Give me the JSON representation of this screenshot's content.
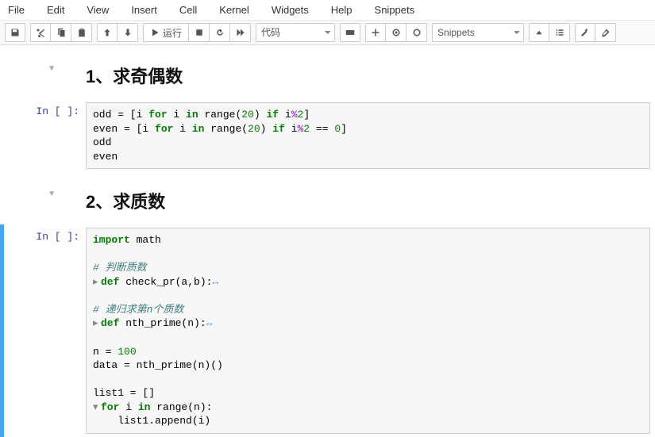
{
  "menu": {
    "file": "File",
    "edit": "Edit",
    "view": "View",
    "insert": "Insert",
    "cell": "Cell",
    "kernel": "Kernel",
    "widgets": "Widgets",
    "help": "Help",
    "snippets": "Snippets"
  },
  "toolbar": {
    "run_label": "运行",
    "celltype_selected": "代码",
    "snippets_selected": "Snippets"
  },
  "cells": {
    "md1_heading": "1、求奇偶数",
    "md2_heading": "2、求质数",
    "prompt1": "In [ ]:",
    "prompt2": "In [ ]:",
    "code1": {
      "l1a": "odd = [i ",
      "l1b": "for",
      "l1c": " i ",
      "l1d": "in",
      "l1e": " range(",
      "l1f": "20",
      "l1g": ") ",
      "l1h": "if",
      "l1i": " i",
      "l1j": "%",
      "l1k": "2",
      "l1l": "]",
      "l2a": "even = [i ",
      "l2b": "for",
      "l2c": " i ",
      "l2d": "in",
      "l2e": " range(",
      "l2f": "20",
      "l2g": ") ",
      "l2h": "if",
      "l2i": " i",
      "l2j": "%",
      "l2k": "2",
      "l2l": " == ",
      "l2m": "0",
      "l2n": "]",
      "l3": "odd",
      "l4": "even"
    },
    "code2": {
      "l1a": "import",
      "l1b": " math",
      "l3": "# 判断质数",
      "l4a": "def",
      "l4b": " check_pr(a,b):",
      "l6": "# 递归求第n个质数",
      "l7a": "def",
      "l7b": " nth_prime(n):",
      "l9a": "n = ",
      "l9b": "100",
      "l10": "data = nth_prime(n)()",
      "l12": "list1 = []",
      "l13a": "for",
      "l13b": " i ",
      "l13c": "in",
      "l13d": " range(n):",
      "l14": "    list1.append(i)"
    }
  }
}
